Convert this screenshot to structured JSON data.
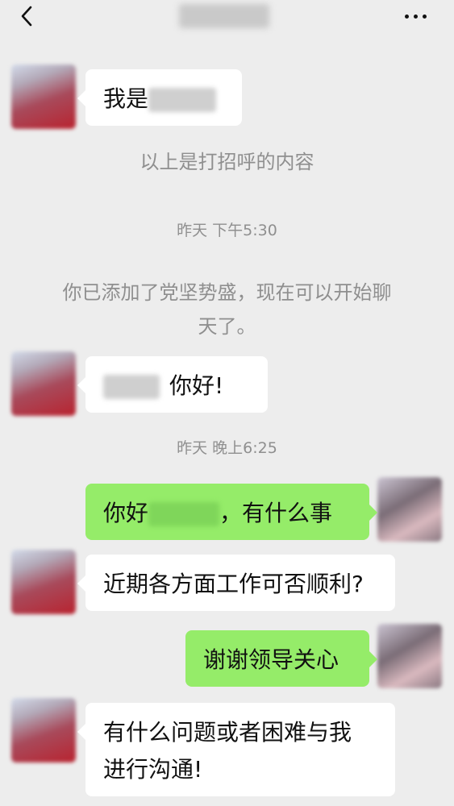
{
  "header": {
    "back_icon": "chevron-left-icon",
    "contact_name": "",
    "more_icon": "more-dots-icon"
  },
  "messages": {
    "m1": {
      "prefix": "我是",
      "suffix": ""
    },
    "notice1": "以上是打招呼的内容",
    "time1": "昨天 下午5:30",
    "notice2_line1": "你已添加了党坚势盛，现在可以开始聊",
    "notice2_line2": "天了。",
    "m2": {
      "text": "你好!"
    },
    "time2": "昨天 晚上6:25",
    "m3": {
      "prefix": "你好",
      "suffix": "，有什么事"
    },
    "m4": {
      "text": "近期各方面工作可否顺利?"
    },
    "m5": {
      "text": "谢谢领导关心"
    },
    "m6": {
      "line1": "有什么问题或者困难与我",
      "line2": "进行沟通!"
    }
  },
  "colors": {
    "background": "#ededed",
    "incoming_bubble": "#ffffff",
    "outgoing_bubble": "#95ec69",
    "system_text": "#8f8f8f"
  }
}
